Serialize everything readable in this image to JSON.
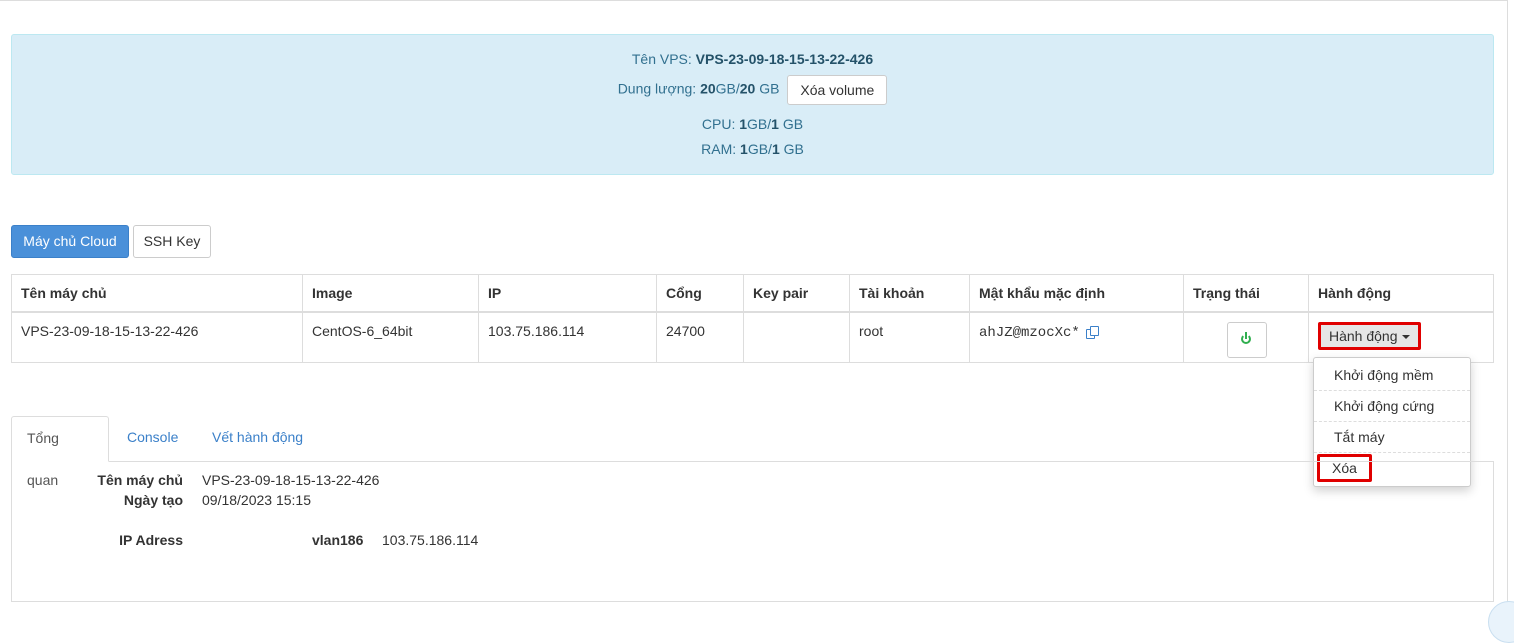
{
  "info": {
    "vps_name_label": "Tên VPS:",
    "vps_name": "VPS-23-09-18-15-13-22-426",
    "storage_label": "Dung lượng:",
    "storage_used": "20",
    "storage_unit1": "GB/",
    "storage_total": "20",
    "storage_unit2": "GB",
    "delete_volume": "Xóa volume",
    "cpu_label": "CPU:",
    "cpu_used": "1",
    "cpu_unit1": "GB/",
    "cpu_total": "1",
    "cpu_unit2": "GB",
    "ram_label": "RAM:",
    "ram_used": "1",
    "ram_unit1": "GB/",
    "ram_total": "1",
    "ram_unit2": "GB"
  },
  "buttons": {
    "cloud_server": "Máy chủ Cloud",
    "ssh_key": "SSH Key"
  },
  "table": {
    "headers": [
      "Tên máy chủ",
      "Image",
      "IP",
      "Cổng",
      "Key pair",
      "Tài khoản",
      "Mật khẩu mặc định",
      "Trạng thái",
      "Hành động"
    ],
    "row": {
      "name": "VPS-23-09-18-15-13-22-426",
      "image": "CentOS-6_64bit",
      "ip": "103.75.186.114",
      "port": "24700",
      "keypair": "",
      "account": "root",
      "password": "ahJZ@mzocXc*",
      "action_label": "Hành động"
    }
  },
  "dropdown": {
    "items": [
      "Khởi động mềm",
      "Khởi động cứng",
      "Tắt máy",
      "Xóa"
    ]
  },
  "tabs": [
    "Tổng quan",
    "Console",
    "Vết hành động"
  ],
  "overview": {
    "name_label": "Tên máy chủ",
    "name_value": "VPS-23-09-18-15-13-22-426",
    "created_label": "Ngày tạo",
    "created_value": "09/18/2023 15:15",
    "ip_label": "IP Adress",
    "vlan_label": "vlan186",
    "ip_value": "103.75.186.114"
  },
  "colors": {
    "primary": "#4a90d9",
    "highlight": "#e00000",
    "power_on": "#2fae4e",
    "info_bg": "#d9edf7"
  }
}
